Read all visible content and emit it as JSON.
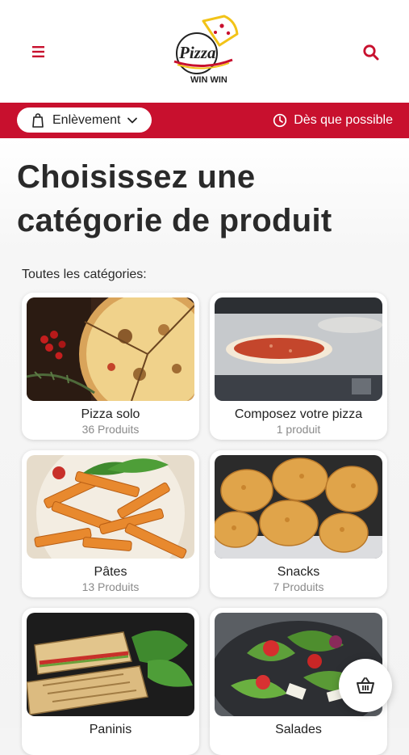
{
  "header": {
    "menu_icon": "hamburger-icon",
    "search_icon": "search-icon",
    "logo": {
      "line1": "Pizza",
      "line2": "WIN WIN"
    }
  },
  "order_bar": {
    "mode_icon": "bag-icon",
    "mode_label": "Enlèvement",
    "mode_chevron": "chevron-down-icon",
    "time_icon": "clock-icon",
    "time_label": "Dès que possible"
  },
  "page": {
    "title_line1": "Choisissez une",
    "title_line2": "catégorie de produit",
    "subtitle": "Toutes les catégories:"
  },
  "categories": [
    {
      "name": "Pizza solo",
      "count": "36 Produits"
    },
    {
      "name": "Composez votre pizza",
      "count": "1 produit"
    },
    {
      "name": "Pâtes",
      "count": "13 Produits"
    },
    {
      "name": "Snacks",
      "count": "7 Produits"
    },
    {
      "name": "Paninis",
      "count": ""
    },
    {
      "name": "Salades",
      "count": ""
    }
  ],
  "cart": {
    "icon": "basket-icon"
  },
  "colors": {
    "brand_red": "#c8102e",
    "logo_yellow": "#f2c318"
  }
}
